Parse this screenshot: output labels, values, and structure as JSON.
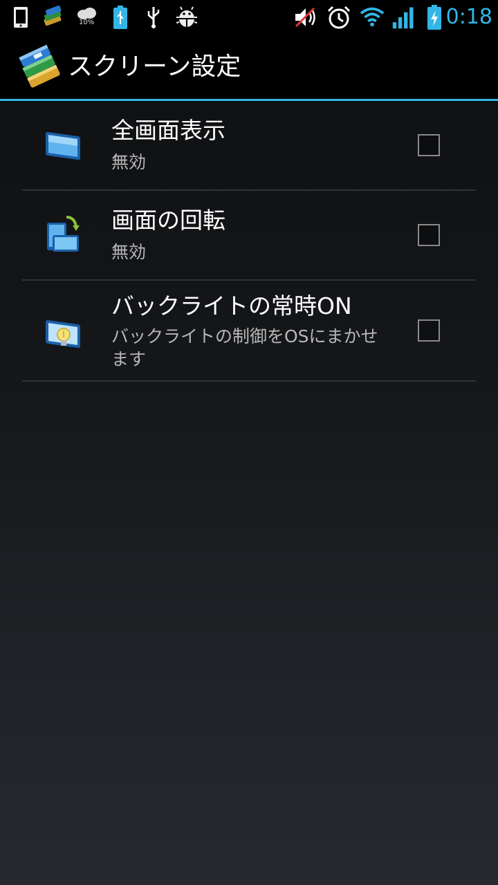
{
  "status_bar": {
    "time": "0:18",
    "weather_percent": "10%",
    "icons": [
      "phone-icon",
      "books-icon",
      "weather-cloud-icon",
      "battery-usb-icon",
      "usb-icon",
      "android-debug-icon",
      "mute-icon",
      "alarm-icon",
      "wifi-icon",
      "signal-icon",
      "battery-charging-icon"
    ],
    "accent_color": "#33b5e5"
  },
  "action_bar": {
    "title": "スクリーン設定",
    "icon": "books-app-icon"
  },
  "preferences": [
    {
      "title": "全画面表示",
      "summary": "無効",
      "icon": "screen-fullscreen-icon",
      "checked": false
    },
    {
      "title": "画面の回転",
      "summary": "無効",
      "icon": "screen-rotate-icon",
      "checked": false
    },
    {
      "title": "バックライトの常時ON",
      "summary": "バックライトの制御をOSにまかせます",
      "icon": "screen-backlight-icon",
      "checked": false
    }
  ]
}
